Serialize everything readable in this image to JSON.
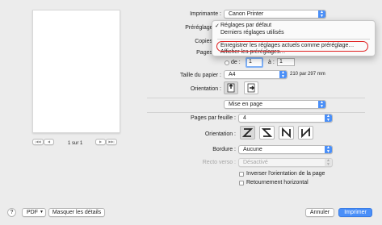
{
  "preview": {
    "page_counter": "1 sur 1",
    "first_label": "|◀◀",
    "prev_label": "◀",
    "next_label": "▶",
    "last_label": "▶▶|"
  },
  "printer": {
    "label": "Imprimante :",
    "value": "Canon Printer"
  },
  "presets": {
    "label": "Préréglages",
    "menu": {
      "selected_mark": "✓",
      "items": [
        "Réglages par défaut",
        "Derniers réglages utilisés",
        "Enregistrer les réglages actuels comme préréglage…",
        "Afficher les préréglages…"
      ]
    }
  },
  "copies": {
    "label": "Copies"
  },
  "pages": {
    "label": "Pages",
    "range_label": "de :",
    "from_value": "1",
    "to_label": "à :",
    "to_value": "1"
  },
  "paper_size": {
    "label": "Taille du papier :",
    "value": "A4",
    "dimensions": "210 par 297 mm"
  },
  "orientation": {
    "label": "Orientation :"
  },
  "section_popup": {
    "value": "Mise en page"
  },
  "layout": {
    "pages_per_sheet_label": "Pages par feuille :",
    "pages_per_sheet_value": "4",
    "orientation_label": "Orientation :",
    "border_label": "Bordure :",
    "border_value": "Aucune",
    "duplex_label": "Recto verso :",
    "duplex_value": "Désactivé",
    "reverse_label": "Inverser l'orientation de la page",
    "flip_label": "Retournement horizontal"
  },
  "footer": {
    "help": "?",
    "pdf_label": "PDF",
    "details_label": "Masquer les détails",
    "cancel_label": "Annuler",
    "print_label": "Imprimer"
  }
}
